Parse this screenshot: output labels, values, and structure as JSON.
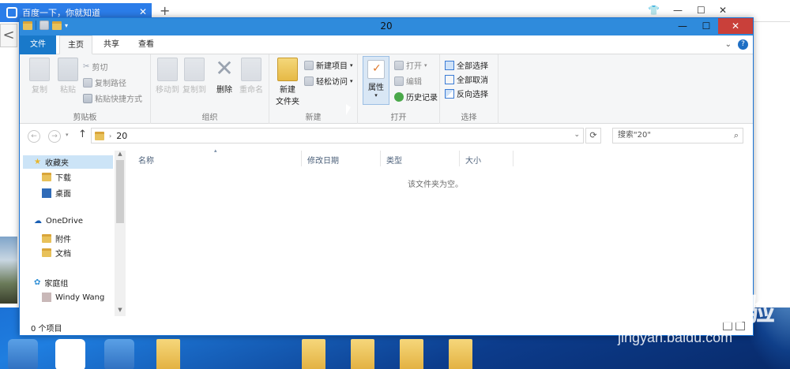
{
  "browser": {
    "tab_title": "百度一下，你就知道",
    "tab_close": "✕",
    "new_tab": "+",
    "back": "<"
  },
  "window": {
    "title": "20",
    "minimize": "—",
    "maximize": "☐",
    "close": "✕"
  },
  "menubar": {
    "file": "文件",
    "home": "主页",
    "share": "共享",
    "view": "查看",
    "expand": "⌄",
    "help": "?"
  },
  "ribbon": {
    "clipboard": {
      "label": "剪贴板",
      "copy": "复制",
      "paste": "粘贴",
      "cut": "剪切",
      "copy_path": "复制路径",
      "paste_shortcut": "粘贴快捷方式"
    },
    "organize": {
      "label": "组织",
      "move_to": "移动到",
      "copy_to": "复制到",
      "delete": "删除",
      "rename": "重命名"
    },
    "new": {
      "label": "新建",
      "new_folder_l1": "新建",
      "new_folder_l2": "文件夹",
      "new_item": "新建项目",
      "easy_access": "轻松访问"
    },
    "open": {
      "label": "打开",
      "properties": "属性",
      "open": "打开",
      "edit": "编辑",
      "history": "历史记录"
    },
    "select": {
      "label": "选择",
      "select_all": "全部选择",
      "select_none": "全部取消",
      "invert": "反向选择"
    }
  },
  "address": {
    "path": "20",
    "search_placeholder": "搜索\"20\""
  },
  "navpane": {
    "favorites": "收藏夹",
    "downloads": "下载",
    "desktop": "桌面",
    "onedrive": "OneDrive",
    "attachments": "附件",
    "documents": "文档",
    "homegroup": "家庭组",
    "user": "Windy Wang"
  },
  "columns": {
    "name": "名称",
    "modified": "修改日期",
    "type": "类型",
    "size": "大小"
  },
  "content": {
    "empty_message": "该文件夹为空。"
  },
  "status": {
    "item_count": "0 个项目"
  },
  "watermark": {
    "main": "Bai du 经验",
    "sub": "jingyan.baidu.com"
  }
}
